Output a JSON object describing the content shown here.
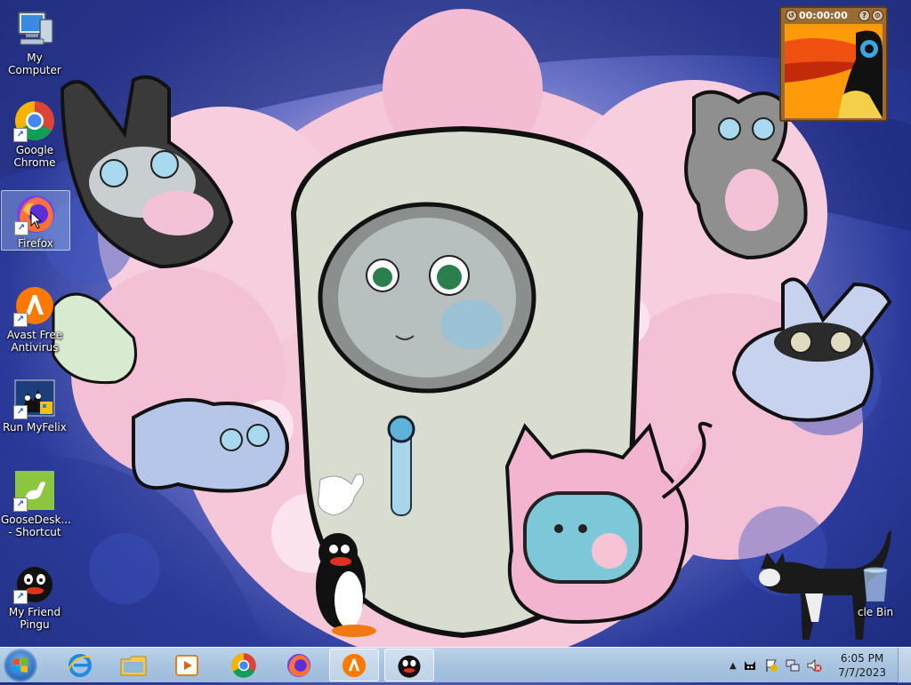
{
  "desktop": {
    "icons": [
      {
        "label": "My Computer",
        "icon": "computer-icon"
      },
      {
        "label": "Google Chrome",
        "icon": "chrome-icon"
      },
      {
        "label": "Firefox",
        "icon": "firefox-icon"
      },
      {
        "label": "Avast Free Antivirus",
        "icon": "avast-icon"
      },
      {
        "label": "Run MyFelix",
        "icon": "myfelix-icon"
      },
      {
        "label": "GooseDesk... - Shortcut",
        "icon": "goose-icon"
      },
      {
        "label": "My Friend Pingu",
        "icon": "pingu-icon"
      },
      {
        "label": "cle Bin",
        "icon": "recycle-bin-icon"
      }
    ]
  },
  "gadget": {
    "time": "00:00:00"
  },
  "taskbar": {
    "apps": [
      "internet-explorer-icon",
      "file-explorer-icon",
      "media-player-icon",
      "chrome-icon",
      "firefox-icon",
      "avast-icon",
      "pingu-icon"
    ],
    "clock_time": "6:05 PM",
    "clock_date": "7/7/2023"
  }
}
